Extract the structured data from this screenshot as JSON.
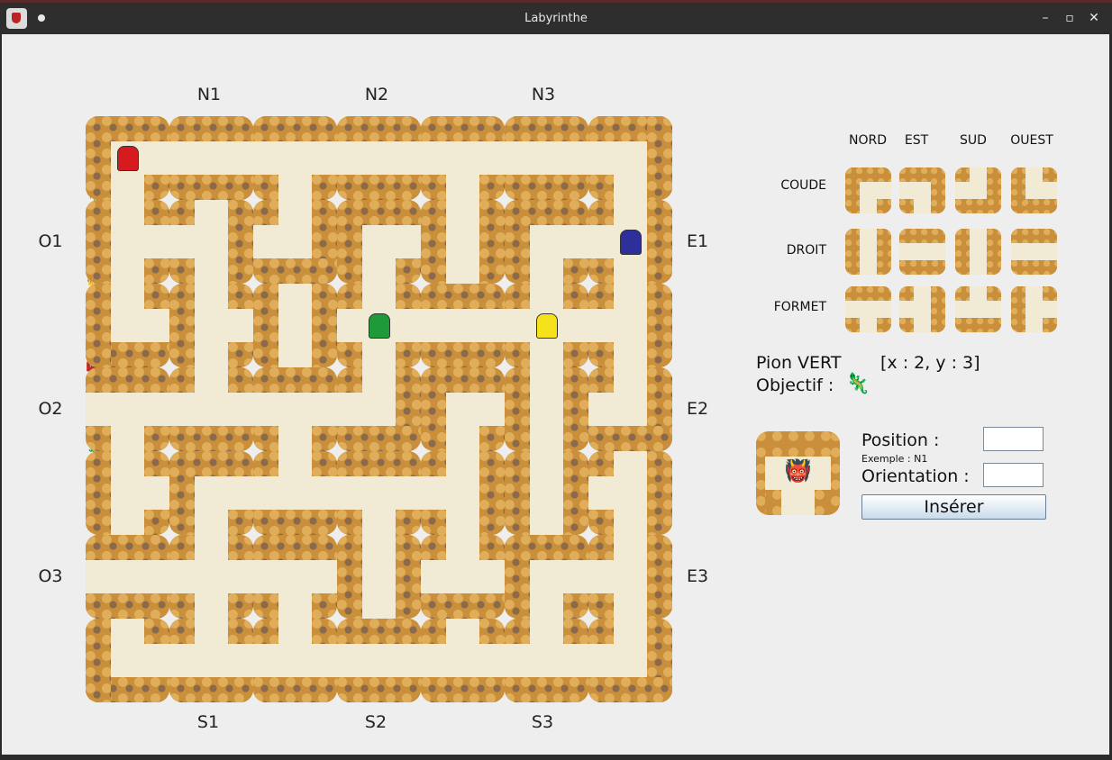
{
  "window": {
    "title": "Labyrinthe"
  },
  "board_labels": {
    "north": [
      "N1",
      "N2",
      "N3"
    ],
    "south": [
      "S1",
      "S2",
      "S3"
    ],
    "west": [
      "O1",
      "O2",
      "O3"
    ],
    "east": [
      "E1",
      "E2",
      "E3"
    ]
  },
  "treasure_icons": [
    {
      "name": "key-icon",
      "glyph": "🔑"
    },
    {
      "name": "rabbit-icon",
      "glyph": "🐇"
    },
    {
      "name": "book-icon",
      "glyph": "📖"
    },
    {
      "name": "sword-icon",
      "glyph": "🗡"
    },
    {
      "name": "beetle-icon",
      "glyph": "🪲"
    },
    {
      "name": "ring-icon",
      "glyph": "💍"
    },
    {
      "name": "knight-icon",
      "glyph": "♞"
    },
    {
      "name": "rat-icon",
      "glyph": "🐀"
    },
    {
      "name": "owl-icon",
      "glyph": "🦉"
    },
    {
      "name": "crown-icon",
      "glyph": "👑"
    },
    {
      "name": "fairy-icon",
      "glyph": "🧚"
    },
    {
      "name": "genie-icon",
      "glyph": "🧞"
    },
    {
      "name": "spider-icon",
      "glyph": "🕷"
    },
    {
      "name": "emerald-icon",
      "glyph": "💎"
    },
    {
      "name": "chest-icon",
      "glyph": "🧰"
    },
    {
      "name": "candelabra-icon",
      "glyph": "🕯"
    },
    {
      "name": "bat-icon",
      "glyph": "🦇"
    },
    {
      "name": "ghost-icon",
      "glyph": "👻"
    },
    {
      "name": "skull-icon",
      "glyph": "💀"
    },
    {
      "name": "lizard-icon",
      "glyph": "🦎"
    }
  ],
  "pawns": {
    "red": "#d71920",
    "blue": "#2e2f9a",
    "green": "#1f9a3a",
    "yellow": "#f5e21b"
  },
  "side_panel": {
    "headers": [
      "NORD",
      "EST",
      "SUD",
      "OUEST"
    ],
    "rows": [
      "COUDE",
      "DROIT",
      "FORMET"
    ],
    "pawn_label": "Pion VERT",
    "coords": "[x : 2,  y : 3]",
    "objective_label": "Objectif :",
    "objective_icon": "lizard-icon",
    "position_label": "Position :",
    "position_value": "",
    "example": "Exemple : N1",
    "orientation_label": "Orientation :",
    "orientation_value": "",
    "insert_button": "Insérer",
    "current_tile_treasure": "troll-icon"
  },
  "colors": {
    "path": "#f1ead4",
    "wall": "#c98f3a",
    "panel_bg": "#eeeeee"
  }
}
